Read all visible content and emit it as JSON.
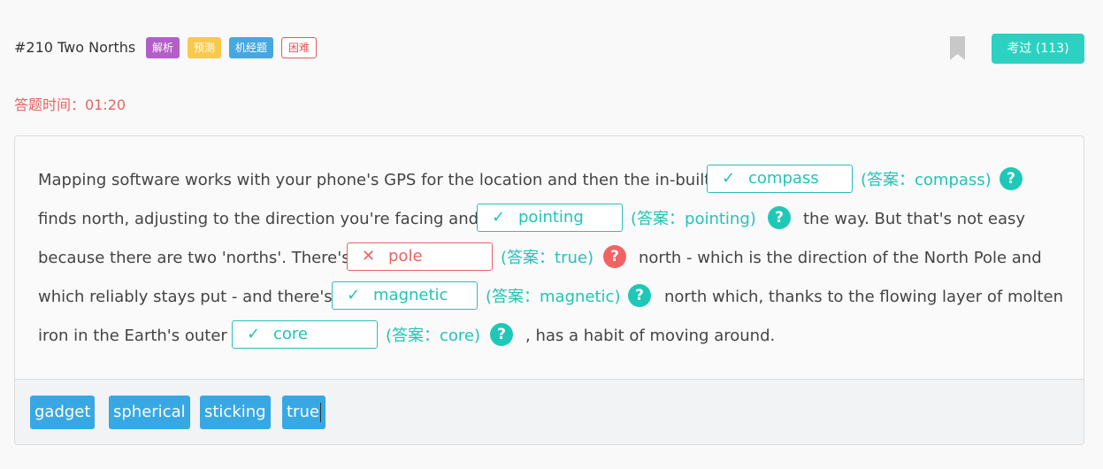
{
  "header": {
    "title": "#210 Two Norths",
    "tags": [
      "解析",
      "预测",
      "机经题",
      "困难"
    ],
    "pass_button": "考过 (113)"
  },
  "timer": "答题时间：01:20",
  "question": {
    "segments": [
      "Mapping software works with your phone's GPS for the location and then the in-built",
      "finds north, adjusting to the direction you're facing and",
      "the way. But that's not easy",
      "because there are two 'norths'. There's",
      "north - which is the direction of the North Pole and",
      "which reliably stays put - and there's",
      "north which, thanks to the flowing layer of molten",
      "iron in the Earth's outer",
      ", has a habit of moving around."
    ],
    "blanks": [
      {
        "value": "compass",
        "status": "correct",
        "mark": "✓",
        "answer": "(答案：compass)"
      },
      {
        "value": "pointing",
        "status": "correct",
        "mark": "✓",
        "answer": "(答案：pointing)"
      },
      {
        "value": "pole",
        "status": "wrong",
        "mark": "✕",
        "answer": "(答案：true)"
      },
      {
        "value": "magnetic",
        "status": "correct",
        "mark": "✓",
        "answer": "(答案：magnetic)"
      },
      {
        "value": "core",
        "status": "correct",
        "mark": "✓",
        "answer": "(答案：core)"
      }
    ],
    "help_glyph": "?"
  },
  "options": [
    "gadget",
    "spherical",
    "sticking",
    "true"
  ],
  "colors": {
    "accent": "#2cd1c1",
    "correct": "#22c3b8",
    "wrong": "#e96262",
    "option_bg": "#37a8e4"
  },
  "icons": {
    "bookmark": "bookmark-icon",
    "help": "question-circle-icon"
  }
}
